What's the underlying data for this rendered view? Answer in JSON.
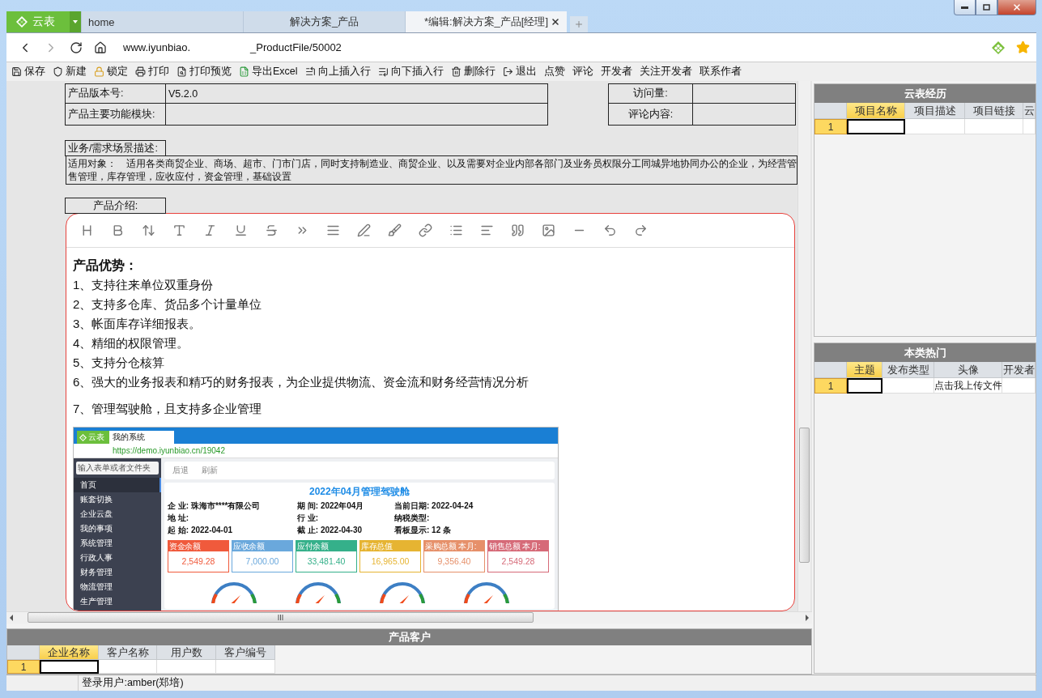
{
  "browser": {
    "logo": "云表",
    "tabs": [
      {
        "label": "home",
        "selected": false
      },
      {
        "label": "解决方案_产品",
        "selected": false
      },
      {
        "label": "*编辑:解决方案_产品[经理]",
        "selected": true
      }
    ],
    "url_parts": [
      "www.iyunbiao.",
      "_ProductFile/50002"
    ]
  },
  "toolbar": [
    "保存",
    "新建",
    "锁定",
    "打印",
    "打印预览",
    "导出Excel",
    "向上插入行",
    "向下插入行",
    "删除行",
    "退出",
    "点赞",
    "评论",
    "开发者",
    "关注开发者",
    "联系作者"
  ],
  "form": {
    "rows": [
      {
        "label": "产品版本号:",
        "value": "V5.2.0",
        "side_label": "访问量:"
      },
      {
        "label": "产品主要功能模块:",
        "side_label": "评论内容:"
      }
    ],
    "scenario_label": "业务/需求场景描述:",
    "scenario_lines": [
      "适用对象：　适用各类商贸企业、商场、超市、门市门店，同时支持制造业、商贸企业、以及需要对企业内部各部门及业务员权限分工同城异地协同办公的企业，为经营管",
      "售管理，库存管理，应收应付，资金管理，基础设置"
    ],
    "intro_label": "产品介绍:"
  },
  "editor": {
    "heading": "产品优势：",
    "lines": [
      "1、支持往来单位双重身份",
      "2、支持多仓库、货品多个计量单位",
      "3、帐面库存详细报表。",
      "4、精细的权限管理。",
      "5、支持分仓核算",
      "6、强大的业务报表和精巧的财务报表，为企业提供物流、资金流和财务经营情况分析",
      "7、管理驾驶舱，且支持多企业管理"
    ],
    "screenshot": {
      "logo": "云表",
      "tab": "我的系统",
      "url": "https://demo.iyunbiao.cn/19042",
      "search_placeholder": "输入表单或者文件夹",
      "nav": [
        {
          "label": "首页",
          "selected": true
        },
        {
          "label": "账套切换",
          "selected": false
        },
        {
          "label": "企业云盘",
          "selected": false
        },
        {
          "label": "我的事项",
          "selected": false
        },
        {
          "label": "系统管理",
          "selected": false
        },
        {
          "label": "行政人事",
          "selected": false
        },
        {
          "label": "财务管理",
          "selected": false
        },
        {
          "label": "物流管理",
          "selected": false
        },
        {
          "label": "生产管理",
          "selected": false
        }
      ],
      "actions": [
        "后退",
        "刷新"
      ],
      "title": "2022年04月管理驾驶舱",
      "info": [
        {
          "label": "企 业:",
          "value": "珠海市****有限公司"
        },
        {
          "label": "期 间:",
          "value": "2022年04月"
        },
        {
          "label": "当前日期:",
          "value": "2022-04-24"
        },
        {
          "label": "地 址:"
        },
        {
          "label": "行 业:"
        },
        {
          "label": "纳税类型:"
        },
        {
          "label": "起 始:",
          "value": "2022-04-01"
        },
        {
          "label": "截 止:",
          "value": "2022-04-30"
        },
        {
          "label": "看板显示:",
          "value": "12",
          "unit": "条"
        }
      ],
      "cards": [
        {
          "label": "资金余额",
          "value": "2,549.28",
          "color": "#f05a3c"
        },
        {
          "label": "应收余额",
          "value": "7,000.00",
          "color": "#6aa8dc"
        },
        {
          "label": "应付余额",
          "value": "33,481.40",
          "color": "#35b08a"
        },
        {
          "label": "库存总值",
          "value": "16,965.00",
          "color": "#e6b432"
        },
        {
          "label": "采购总额 本月:",
          "value": "9,356.40",
          "color": "#e6906a"
        },
        {
          "label": "销售总额 本月:",
          "value": "2,549.28",
          "color": "#d66a78"
        }
      ]
    }
  },
  "customers": {
    "title": "产品客户",
    "columns": [
      {
        "label": "企业名称",
        "selected": true
      },
      {
        "label": "客户名称",
        "selected": false
      },
      {
        "label": "用户数",
        "selected": false
      },
      {
        "label": "客户编号",
        "selected": false
      }
    ],
    "rows": [
      {
        "number": "1",
        "selected": true,
        "cells": [
          {
            "current": true
          }
        ]
      }
    ]
  },
  "side_panels": [
    {
      "title": "云表经历",
      "columns": [
        {
          "label": "项目名称",
          "selected": true
        },
        {
          "label": "项目描述",
          "selected": false
        },
        {
          "label": "项目链接",
          "selected": false
        },
        {
          "label": "云",
          "selected": false
        }
      ],
      "rows": [
        {
          "number": "1",
          "selected": true,
          "cells": [
            {
              "current": true
            }
          ]
        }
      ]
    },
    {
      "title": "本类热门",
      "columns": [
        {
          "label": "主题",
          "selected": true
        },
        {
          "label": "发布类型",
          "selected": false
        },
        {
          "label": "头像",
          "selected": false
        },
        {
          "label": "开发者",
          "selected": false
        }
      ],
      "rows": [
        {
          "number": "1",
          "selected": true,
          "cells": [
            {
              "current": true
            },
            {
              "current": false
            },
            {
              "text": "点击我上传文件",
              "current": false
            }
          ]
        }
      ]
    }
  ],
  "status_bar": {
    "user": "登录用户:amber(郑培)"
  }
}
